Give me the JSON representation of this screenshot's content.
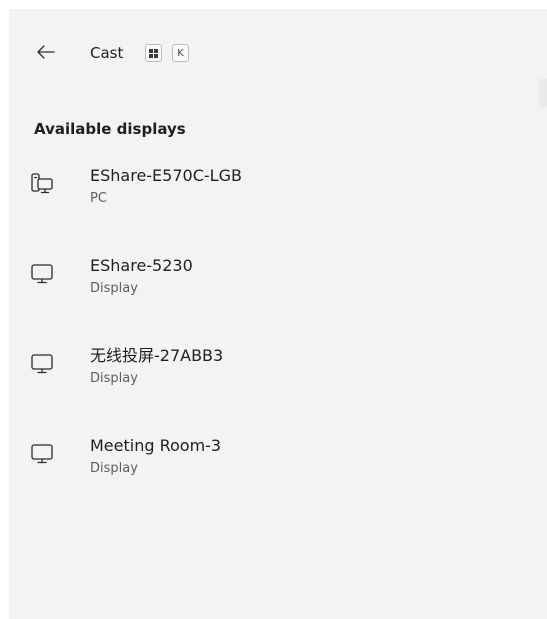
{
  "header": {
    "back_icon": "arrow-left-icon",
    "title": "Cast",
    "shortcut_keys": [
      "windows-key",
      "K"
    ]
  },
  "section": {
    "title": "Available displays"
  },
  "devices": [
    {
      "name": "EShare-E570C-LGB",
      "type": "PC",
      "icon": "pc-icon"
    },
    {
      "name": "EShare-5230",
      "type": "Display",
      "icon": "display-icon"
    },
    {
      "name": "无线投屏-27ABB3",
      "type": "Display",
      "icon": "display-icon"
    },
    {
      "name": "Meeting Room-3",
      "type": "Display",
      "icon": "display-icon"
    }
  ],
  "colors": {
    "panel_background": "#f3f3f3",
    "text_primary": "#1f1f1f",
    "text_secondary": "#5d5d5d"
  }
}
